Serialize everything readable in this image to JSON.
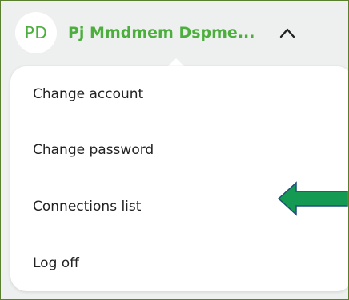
{
  "account": {
    "avatar_initials": "PD",
    "user_name": "Pj Mmdmem Dspme...",
    "accent_color": "#4caf3d"
  },
  "menu": {
    "items": [
      {
        "label": "Change account"
      },
      {
        "label": "Change password"
      },
      {
        "label": "Connections list"
      },
      {
        "label": "Log off"
      }
    ]
  },
  "annotation": {
    "arrow_color": "#149a52",
    "arrow_outline": "#1f4f7a",
    "points_to": "Connections list"
  },
  "icons": {
    "chevron": "chevron-up-icon",
    "arrow": "arrow-left-icon"
  }
}
